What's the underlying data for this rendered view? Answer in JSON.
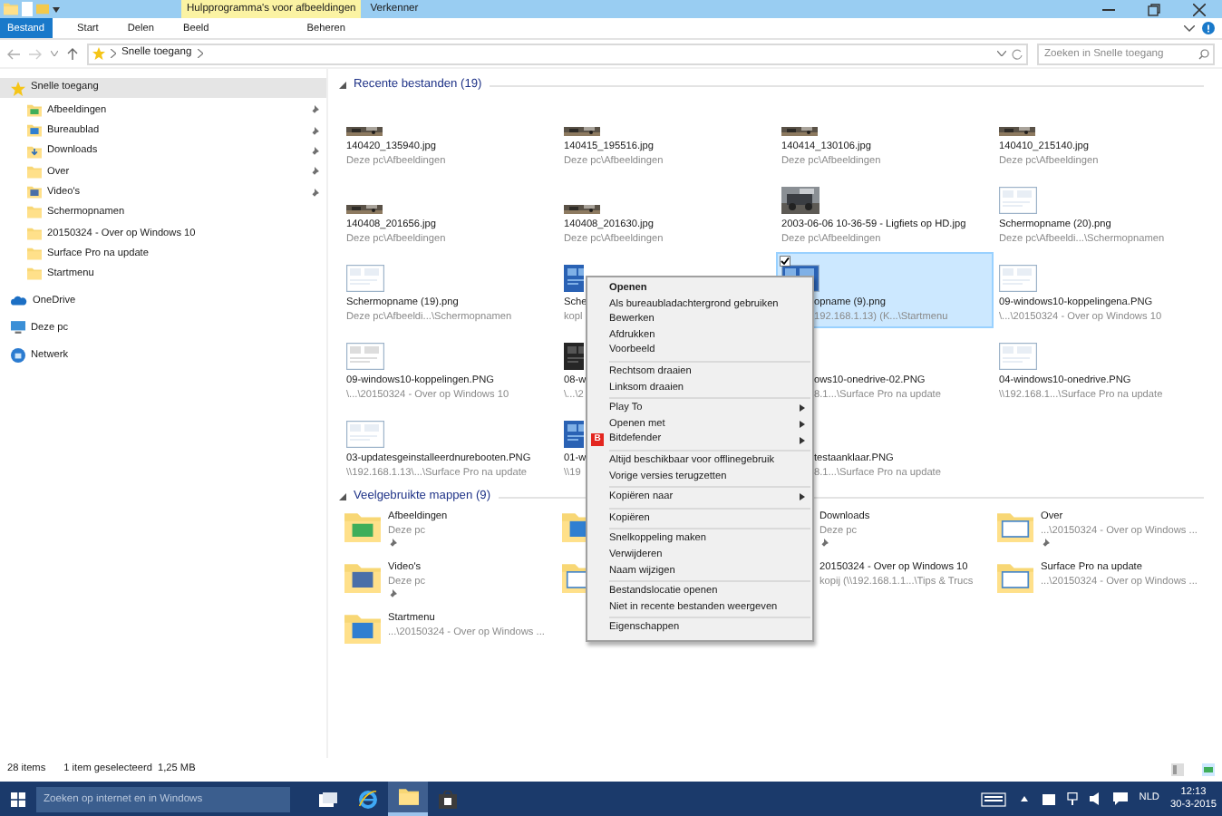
{
  "titlebar": {
    "context_tab": "Hulpprogramma's voor afbeeldingen",
    "title": "Verkenner"
  },
  "ribbon_tabs": [
    {
      "label": "Bestand",
      "kind": "file"
    },
    {
      "label": "Start",
      "kind": "tab"
    },
    {
      "label": "Delen",
      "kind": "tab"
    },
    {
      "label": "Beeld",
      "kind": "tab"
    },
    {
      "label": "Beheren",
      "kind": "context"
    }
  ],
  "address": {
    "path": "Snelle toegang",
    "search_placeholder": "Zoeken in Snelle toegang"
  },
  "sidebar": {
    "items": [
      {
        "label": "Snelle toegang",
        "selected": true,
        "children": [
          {
            "label": "Afbeeldingen",
            "pinned": true,
            "selected": false
          },
          {
            "label": "Bureaublad",
            "pinned": true,
            "selected": false
          },
          {
            "label": "Downloads",
            "pinned": true,
            "selected": false
          },
          {
            "label": "Over",
            "pinned": true,
            "selected": false
          },
          {
            "label": "Video's",
            "pinned": true,
            "selected": false
          },
          {
            "label": "Schermopnamen",
            "pinned": false,
            "selected": false
          },
          {
            "label": "20150324 - Over op Windows 10",
            "pinned": false,
            "selected": false
          },
          {
            "label": "Surface Pro na update",
            "pinned": false,
            "selected": false
          },
          {
            "label": "Startmenu",
            "pinned": false,
            "selected": false
          }
        ]
      },
      {
        "label": "OneDrive",
        "selected": false
      },
      {
        "label": "Deze pc",
        "selected": false
      },
      {
        "label": "Netwerk",
        "selected": false
      }
    ]
  },
  "recent": {
    "title": "Recente bestanden (19)",
    "rows": [
      {
        "items": [
          {
            "name": "140420_135940.jpg",
            "path": "Deze pc\\Afbeeldingen",
            "selected": false,
            "cut_left": false
          },
          {
            "name": "140415_195516.jpg",
            "path": "Deze pc\\Afbeeldingen",
            "selected": false,
            "cut_left": false
          },
          {
            "name": "140414_130106.jpg",
            "path": "Deze pc\\Afbeeldingen",
            "selected": false,
            "cut_left": false
          },
          {
            "name": "140410_215140.jpg",
            "path": "Deze pc\\Afbeeldingen",
            "selected": false,
            "cut_left": false
          }
        ]
      },
      {
        "items": [
          {
            "name": "140408_201656.jpg",
            "path": "Deze pc\\Afbeeldingen",
            "selected": false,
            "cut_left": false
          },
          {
            "name": "140408_201630.jpg",
            "path": "Deze pc\\Afbeeldingen",
            "selected": false,
            "cut_left": false
          },
          {
            "name": "2003-06-06 10-36-59 - Ligfiets op HD.jpg",
            "path": "Deze pc\\Afbeeldingen",
            "selected": false,
            "cut_left": false
          },
          {
            "name": "Schermopname (20).png",
            "path": "Deze pc\\Afbeeldi...\\Schermopnamen",
            "selected": false,
            "cut_left": false
          }
        ]
      },
      {
        "items": [
          {
            "name": "Schermopname (19).png",
            "path": "Deze pc\\Afbeeldi...\\Schermopnamen",
            "selected": false,
            "cut_left": false
          },
          {
            "name": "Sche",
            "path": "kopl",
            "selected": false,
            "cut_left": false
          },
          {
            "name": "opname (9).png",
            "path": "192.168.1.13) (K...\\Startmenu",
            "selected": true,
            "cut_left": true
          },
          {
            "name": "09-windows10-koppelingena.PNG",
            "path": "\\...\\20150324 - Over op Windows 10",
            "selected": false,
            "cut_left": false
          }
        ]
      },
      {
        "items": [
          {
            "name": "09-windows10-koppelingen.PNG",
            "path": "\\...\\20150324 - Over op Windows 10",
            "selected": false,
            "cut_left": false
          },
          {
            "name": "08-w",
            "path": "\\...\\2",
            "selected": false,
            "cut_left": false
          },
          {
            "name": "ows10-onedrive-02.PNG",
            "path": "8.1...\\Surface Pro na update",
            "selected": false,
            "cut_left": true
          },
          {
            "name": "04-windows10-onedrive.PNG",
            "path": "\\\\192.168.1...\\Surface Pro na update",
            "selected": false,
            "cut_left": false
          }
        ]
      },
      {
        "items": [
          {
            "name": "03-updatesgeinstalleerdnurebooten.PNG",
            "path": "\\\\192.168.1.13\\...\\Surface Pro na update",
            "selected": false,
            "cut_left": false
          },
          {
            "name": "01-w",
            "path": "\\\\19",
            "selected": false,
            "cut_left": false
          },
          {
            "name": "testaanklaar.PNG",
            "path": "8.1...\\Surface Pro na update",
            "selected": false,
            "cut_left": true
          }
        ]
      }
    ]
  },
  "frequent": {
    "title": "Veelgebruikte mappen (9)",
    "rows": [
      {
        "items": [
          {
            "kind": "tile",
            "name": "Afbeeldingen",
            "path": "Deze pc",
            "pinned": true
          },
          {
            "kind": "icon_only"
          },
          {
            "kind": "text_only",
            "name": "Downloads",
            "path": "Deze pc",
            "pinned": true
          },
          {
            "kind": "tile",
            "name": "Over",
            "path": "...\\20150324 - Over op Windows ...",
            "pinned": true
          }
        ]
      },
      {
        "items": [
          {
            "kind": "tile",
            "name": "Video's",
            "path": "Deze pc",
            "pinned": true
          },
          {
            "kind": "icon_only"
          },
          {
            "kind": "text_only",
            "name": "20150324 - Over op Windows 10",
            "path": "kopij (\\\\192.168.1.1...\\Tips & Trucs",
            "pinned": false
          },
          {
            "kind": "tile",
            "name": "Surface Pro na update",
            "path": "...\\20150324 - Over op Windows ...",
            "pinned": false
          }
        ]
      },
      {
        "items": [
          {
            "kind": "tile",
            "name": "Startmenu",
            "path": "...\\20150324 - Over op Windows ...",
            "pinned": false
          }
        ]
      }
    ]
  },
  "context_menu": {
    "items": [
      {
        "kind": "item",
        "label": "Openen",
        "default": true
      },
      {
        "kind": "item",
        "label": "Als bureaubladachtergrond gebruiken"
      },
      {
        "kind": "item",
        "label": "Bewerken"
      },
      {
        "kind": "item",
        "label": "Afdrukken"
      },
      {
        "kind": "item",
        "label": "Voorbeeld"
      },
      {
        "kind": "separator"
      },
      {
        "kind": "item",
        "label": "Rechtsom draaien"
      },
      {
        "kind": "item",
        "label": "Linksom draaien"
      },
      {
        "kind": "separator"
      },
      {
        "kind": "item",
        "label": "Play To",
        "submenu": true
      },
      {
        "kind": "item",
        "label": "Openen met",
        "submenu": true
      },
      {
        "kind": "item",
        "label": "Bitdefender",
        "submenu": true,
        "badge": "B"
      },
      {
        "kind": "separator"
      },
      {
        "kind": "item",
        "label": "Altijd beschikbaar voor offlinegebruik"
      },
      {
        "kind": "item",
        "label": "Vorige versies terugzetten"
      },
      {
        "kind": "separator"
      },
      {
        "kind": "item",
        "label": "Kopiëren naar",
        "submenu": true
      },
      {
        "kind": "separator"
      },
      {
        "kind": "item",
        "label": "Kopiëren"
      },
      {
        "kind": "separator"
      },
      {
        "kind": "item",
        "label": "Snelkoppeling maken"
      },
      {
        "kind": "item",
        "label": "Verwijderen"
      },
      {
        "kind": "item",
        "label": "Naam wijzigen"
      },
      {
        "kind": "separator"
      },
      {
        "kind": "item",
        "label": "Bestandslocatie openen"
      },
      {
        "kind": "item",
        "label": "Niet in recente bestanden weergeven"
      },
      {
        "kind": "separator"
      },
      {
        "kind": "item",
        "label": "Eigenschappen"
      }
    ]
  },
  "status_bar": {
    "count": "28 items",
    "selection": "1 item geselecteerd",
    "size": "1,25 MB"
  },
  "taskbar": {
    "search_placeholder": "Zoeken op internet en in Windows",
    "apps": [
      {
        "active": false
      },
      {
        "active": false
      },
      {
        "active": true
      },
      {
        "active": false
      }
    ],
    "language": "NLD",
    "time": "12:13",
    "date": "30-3-2015"
  }
}
